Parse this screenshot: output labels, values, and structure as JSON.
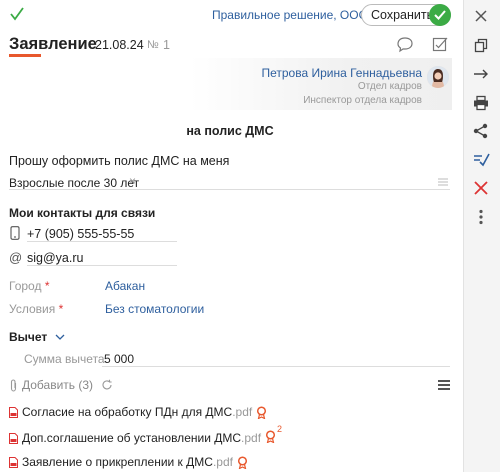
{
  "topbar": {
    "org": "Правильное решение, ООО",
    "save_label": "Сохранить"
  },
  "header": {
    "title": "Заявление",
    "date": "21.08.24",
    "number_sign": "№",
    "number": "1"
  },
  "author": {
    "name": "Петрова Ирина Геннадьевна",
    "department": "Отдел кадров",
    "role": "Инспектор отдела кадров"
  },
  "document": {
    "heading": "на полис ДМС",
    "request": "Прошу оформить полис ДМС на меня",
    "category_value": "Взрослые после 30 лет",
    "contacts_title": "Мои контакты для связи",
    "phone": "+7 (905) 555-55-55",
    "at_sign": "@",
    "email": "sig@ya.ru",
    "city_label": "Город",
    "city_value": "Абакан",
    "conditions_label": "Условия",
    "conditions_value": "Без стоматологии",
    "required_mark": "*",
    "deduction_label": "Вычет",
    "deduction_sum_label": "Сумма вычета",
    "deduction_sum_value": "5 000"
  },
  "attachments": {
    "add_label": "Добавить (3)",
    "files": [
      {
        "name": "Согласие на обработку ПДн для ДМС",
        "ext": ".pdf",
        "badge": ""
      },
      {
        "name": "Доп.соглашение об установлении ДМС",
        "ext": ".pdf",
        "badge": "2"
      },
      {
        "name": "Заявление о прикреплении к ДМС",
        "ext": ".pdf",
        "badge": ""
      }
    ]
  },
  "colors": {
    "accent_orange": "#e8582d",
    "success_green": "#3bab45",
    "link_blue": "#2e5f9e",
    "danger_red": "#d33"
  }
}
